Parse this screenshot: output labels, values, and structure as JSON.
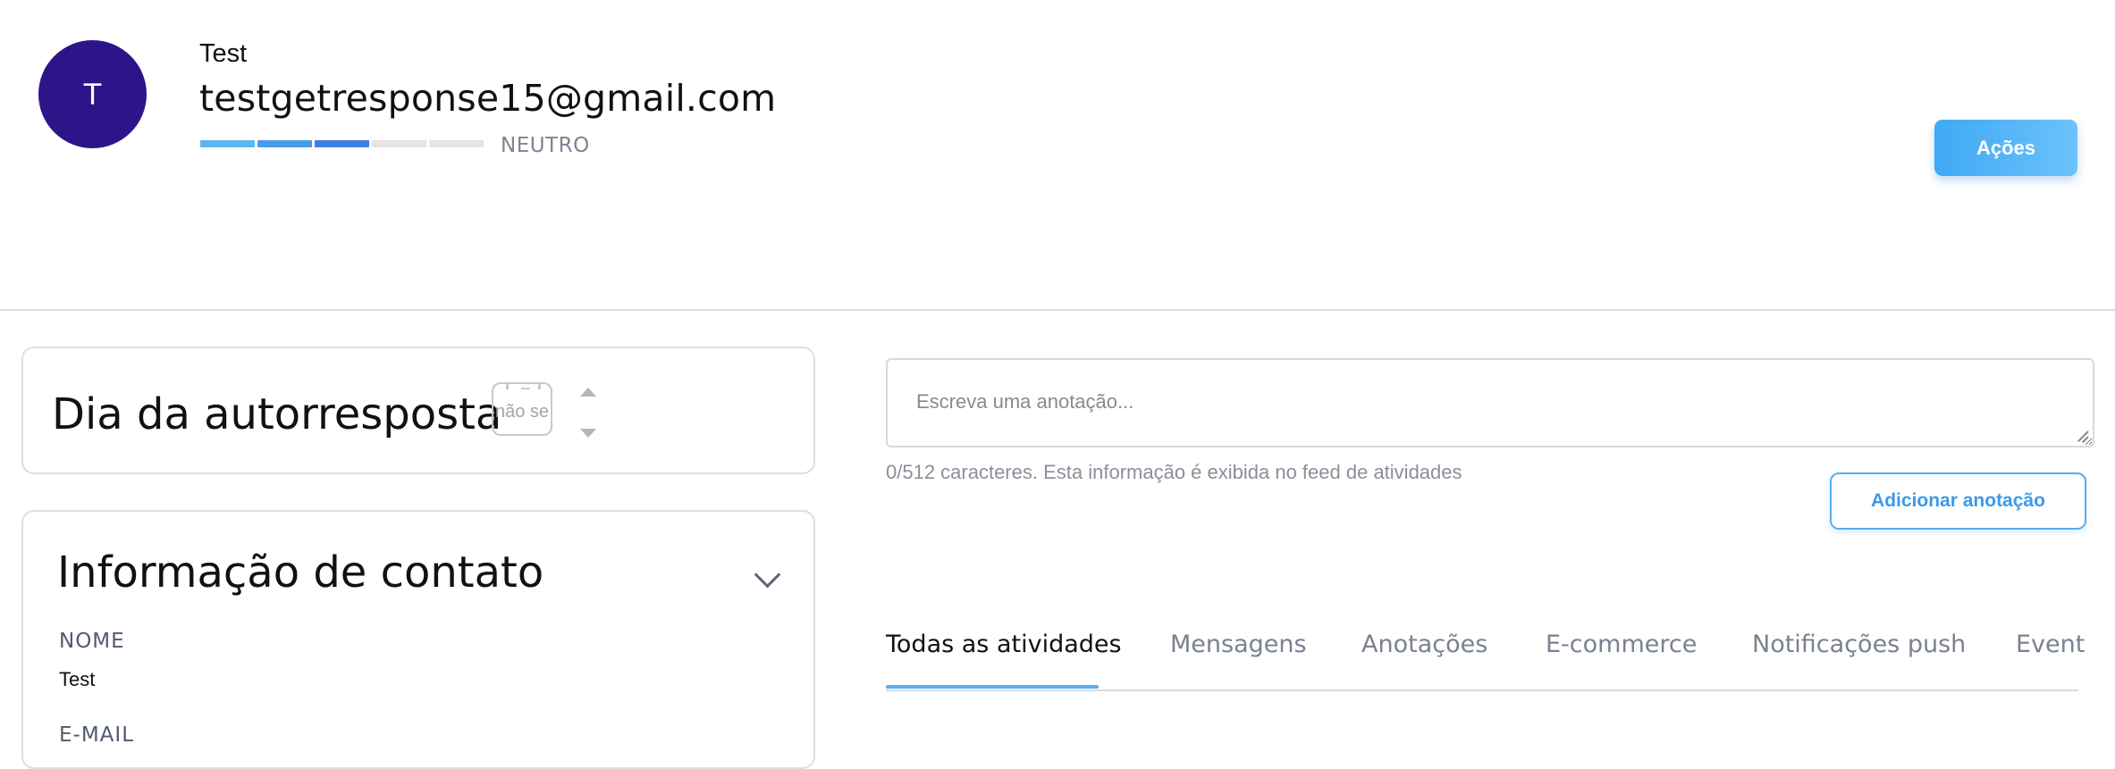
{
  "contact": {
    "initial": "T",
    "name": "Test",
    "email": "testgetresponse15@gmail.com",
    "engagement_label": "NEUTRO",
    "engagement_segments_filled": 3,
    "engagement_segments_total": 5
  },
  "header": {
    "actions_label": "Ações"
  },
  "autoresponder_card": {
    "title": "Dia da autorresposta",
    "day_placeholder": "não se"
  },
  "contact_info_card": {
    "title": "Informação de contato",
    "fields": [
      {
        "label": "NOME",
        "value": "Test"
      },
      {
        "label": "E-MAIL",
        "value": ""
      }
    ]
  },
  "notes": {
    "placeholder": "Escreva uma anotação...",
    "hint": "0/512 caracteres. Esta informação é exibida no feed de atividades",
    "add_label": "Adicionar anotação"
  },
  "activity_tabs": [
    {
      "label": "Todas as atividades",
      "active": true
    },
    {
      "label": "Mensagens",
      "active": false
    },
    {
      "label": "Anotações",
      "active": false
    },
    {
      "label": "E-commerce",
      "active": false
    },
    {
      "label": "Notificações push",
      "active": false
    },
    {
      "label": "Event",
      "active": false
    }
  ],
  "colors": {
    "avatar": "#2e1489",
    "accent": "#3fa9f5",
    "score_segment_1": "#5cb6ef",
    "score_segment_2": "#4a9ae8",
    "score_segment_3": "#3f7fe0",
    "score_empty": "#e4e4e4"
  }
}
